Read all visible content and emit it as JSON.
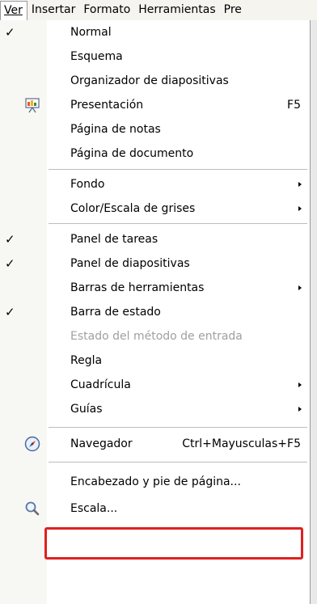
{
  "menubar": {
    "items": [
      {
        "label": "Ver"
      },
      {
        "label": "Insertar"
      },
      {
        "label": "Formato"
      },
      {
        "label": "Herramientas"
      },
      {
        "label": "Pre"
      }
    ]
  },
  "menu": {
    "items": [
      {
        "label": "Normal",
        "checked": true
      },
      {
        "label": "Esquema"
      },
      {
        "label": "Organizador de diapositivas"
      },
      {
        "label": "Presentación",
        "shortcut": "F5",
        "icon": "presentation-icon"
      },
      {
        "label": "Página de notas"
      },
      {
        "label": "Página de documento"
      },
      {
        "label": "Fondo",
        "submenu": true
      },
      {
        "label": "Color/Escala de grises",
        "submenu": true
      },
      {
        "label": "Panel de tareas",
        "checked": true
      },
      {
        "label": "Panel de diapositivas",
        "checked": true
      },
      {
        "label": "Barras de herramientas",
        "submenu": true
      },
      {
        "label": "Barra de estado",
        "checked": true
      },
      {
        "label": "Estado del método de entrada",
        "disabled": true
      },
      {
        "label": "Regla"
      },
      {
        "label": "Cuadrícula",
        "submenu": true
      },
      {
        "label": "Guías",
        "submenu": true
      },
      {
        "label": "Navegador",
        "shortcut": "Ctrl+Mayusculas+F5",
        "icon": "navigator-compass-icon"
      },
      {
        "label": "Encabezado y pie de página...",
        "highlighted": true
      },
      {
        "label": "Escala...",
        "icon": "zoom-magnifier-icon"
      }
    ],
    "check_glyph": "✓",
    "highlight_color": "#e02020"
  }
}
